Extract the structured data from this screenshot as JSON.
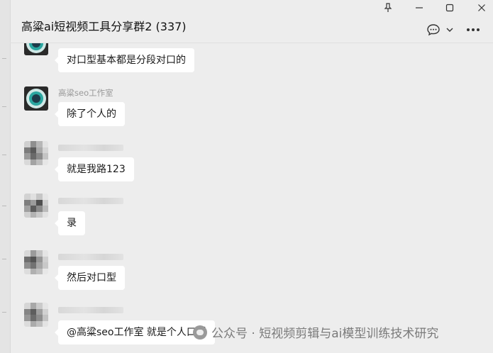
{
  "window": {
    "title": "高粱ai短视频工具分享群2 (337)",
    "controls": {
      "pin": "pin-icon",
      "minimize": "minimize-icon",
      "maximize": "maximize-icon",
      "close": "close-icon"
    }
  },
  "header": {
    "chat_icon": "chat-bubble-icon",
    "dropdown_icon": "chevron-down-icon",
    "more_icon": "more-icon"
  },
  "messages": [
    {
      "sender": "",
      "avatar": "logo",
      "text": "对口型基本都是分段对口的"
    },
    {
      "sender": "高粱seo工作室",
      "avatar": "logo",
      "text": "除了个人的"
    },
    {
      "sender": "",
      "avatar": "mosaic",
      "text": "就是我路123"
    },
    {
      "sender": "",
      "avatar": "mosaic",
      "text": "录"
    },
    {
      "sender": "",
      "avatar": "mosaic",
      "text": "然后对口型"
    },
    {
      "sender": "",
      "avatar": "mosaic",
      "text": "@高粱seo工作室 就是个人口播"
    }
  ],
  "watermark": {
    "text": "公众号 · 短视频剪辑与ai模型训练技术研究"
  }
}
